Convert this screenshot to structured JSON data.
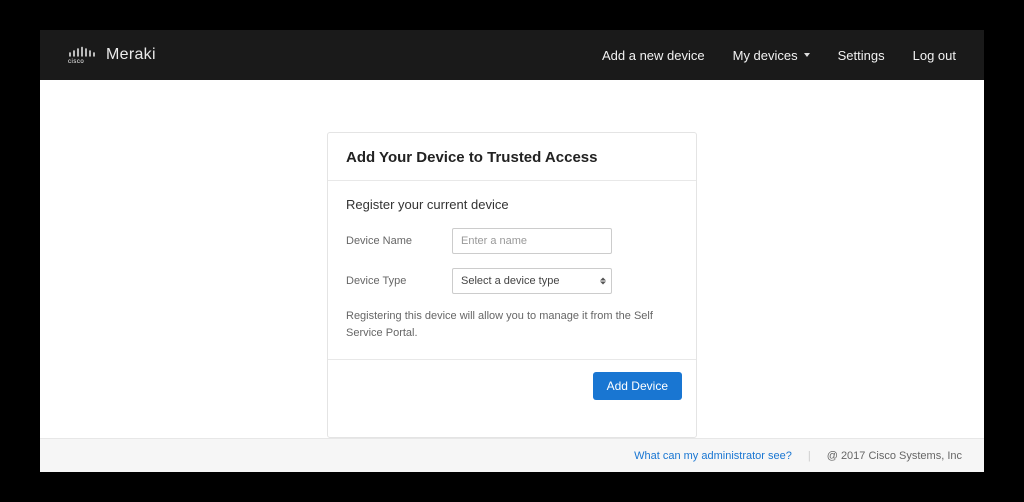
{
  "brand": {
    "cisco": "cisco",
    "meraki": "Meraki"
  },
  "nav": {
    "add_device": "Add a new device",
    "my_devices": "My devices",
    "settings": "Settings",
    "logout": "Log out"
  },
  "panel": {
    "title": "Add Your Device to Trusted Access",
    "subtitle": "Register your current device",
    "device_name_label": "Device Name",
    "device_name_placeholder": "Enter a name",
    "device_type_label": "Device Type",
    "device_type_selected": "Select a device type",
    "hint": "Registering this device will allow you to manage it from the Self Service Portal.",
    "submit_label": "Add Device"
  },
  "footer": {
    "admin_link": "What can my administrator see?",
    "copyright": "@ 2017 Cisco Systems, Inc"
  }
}
